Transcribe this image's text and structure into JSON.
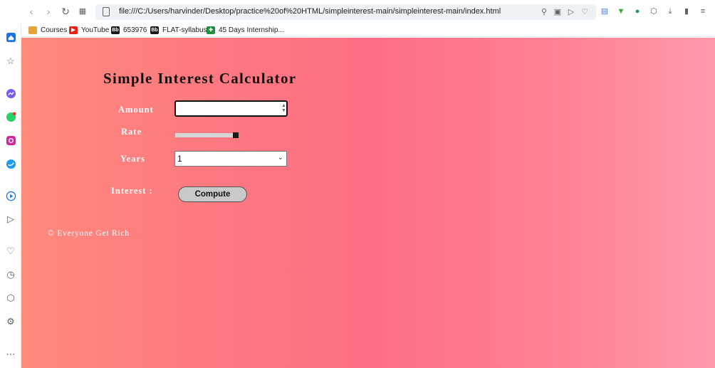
{
  "browser": {
    "url": "file:///C:/Users/harvinder/Desktop/practice%20of%20HTML/simpleinterest-main/simpleinterest-main/index.html",
    "bookmarks": [
      {
        "label": "Courses",
        "icon": "courses-icon",
        "color": "#e8a33a"
      },
      {
        "label": "YouTube",
        "icon": "youtube-icon",
        "color": "#e62117"
      },
      {
        "label": "653976",
        "icon": "blackboard-icon",
        "color": "#1a1a1a",
        "glyph": "Bb"
      },
      {
        "label": "FLAT-syllabus",
        "icon": "blackboard-icon",
        "color": "#1a1a1a",
        "glyph": "Bb"
      },
      {
        "label": "45 Days Internship...",
        "icon": "classroom-icon",
        "color": "#1e8e3e"
      }
    ]
  },
  "sidebar": {
    "items": [
      "home-icon",
      "star-icon",
      "messenger-icon",
      "whatsapp-icon",
      "instagram-icon",
      "twitter-icon",
      "player-icon",
      "send-icon",
      "heart-icon",
      "history-icon",
      "cube-icon",
      "settings-icon",
      "more-icon"
    ]
  },
  "calculator": {
    "title": "Simple Interest Calculator",
    "amount_label": "Amount",
    "amount_value": "",
    "rate_label": "Rate",
    "rate_fraction": 1.0,
    "years_label": "Years",
    "years_value": "1",
    "interest_label": "Interest :",
    "compute_label": "Compute",
    "footer": "© Everyone Get Rich"
  }
}
